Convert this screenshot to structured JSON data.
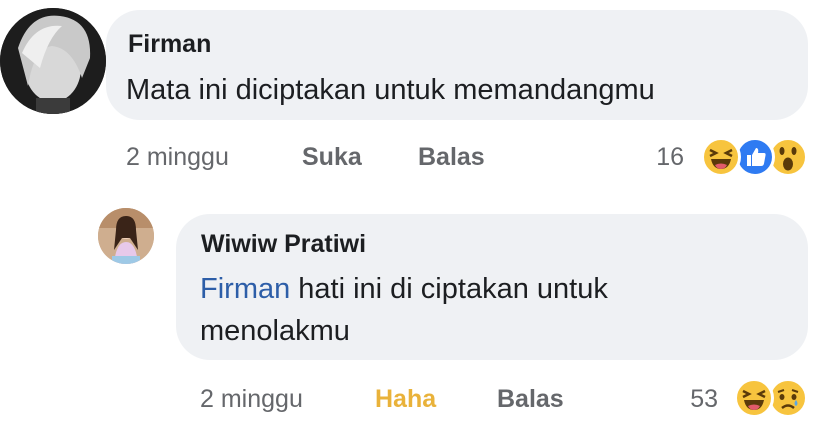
{
  "comments": [
    {
      "author": "Firman",
      "text": "Mata ini diciptakan untuk memandangmu",
      "time": "2 minggu",
      "like_label": "Suka",
      "reply_label": "Balas",
      "reaction_count": "16",
      "reactions": [
        "haha-icon",
        "like-icon",
        "wow-icon"
      ]
    },
    {
      "author": "Wiwiw Pratiwi",
      "mention": "Firman",
      "text_line1": "hati ini di ciptakan untuk",
      "text_line2": "menolakmu",
      "time": "2 minggu",
      "like_label": "Haha",
      "reply_label": "Balas",
      "reaction_count": "53",
      "reactions": [
        "haha-icon",
        "sad-icon"
      ]
    }
  ],
  "colors": {
    "bubble": "#eff1f4",
    "mention": "#2d5ea8",
    "haha_reaction": "#e9b23a",
    "meta_text": "#65676b"
  }
}
